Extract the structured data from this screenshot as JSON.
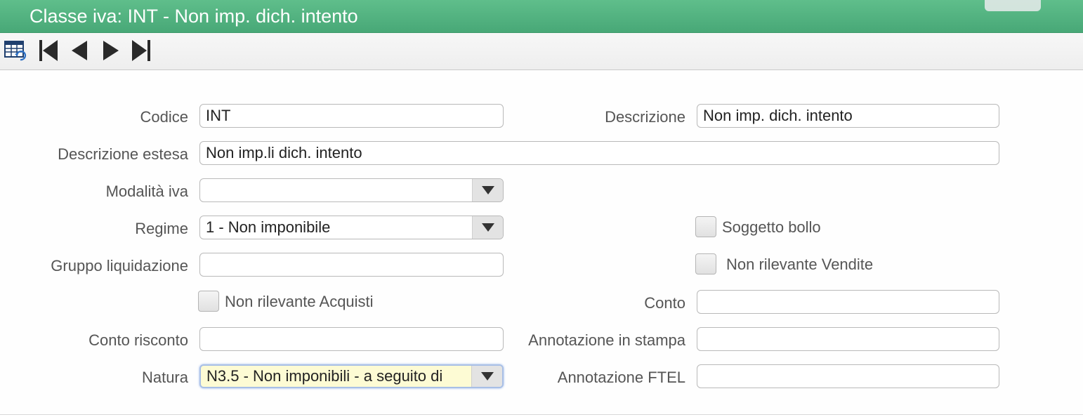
{
  "window": {
    "title": "Classe iva: INT - Non imp. dich. intento"
  },
  "toolbar": {
    "buttons": [
      {
        "name": "table-view-icon"
      },
      {
        "name": "first-record-icon"
      },
      {
        "name": "previous-record-icon"
      },
      {
        "name": "next-record-icon"
      },
      {
        "name": "last-record-icon"
      }
    ]
  },
  "form": {
    "codice": {
      "label": "Codice",
      "value": "INT"
    },
    "descrizione": {
      "label": "Descrizione",
      "value": "Non imp. dich. intento"
    },
    "descrizione_estesa": {
      "label": "Descrizione estesa",
      "value": "Non imp.li dich. intento"
    },
    "modalita_iva": {
      "label": "Modalità iva",
      "value": ""
    },
    "regime": {
      "label": "Regime",
      "value": "1 - Non imponibile"
    },
    "soggetto_bollo": {
      "label": "Soggetto bollo",
      "checked": false
    },
    "gruppo_liquidazione": {
      "label": "Gruppo liquidazione",
      "value": ""
    },
    "non_rilevante_vendite": {
      "label": "Non rilevante Vendite",
      "checked": false
    },
    "non_rilevante_acquisti": {
      "label": "Non rilevante Acquisti",
      "checked": false
    },
    "conto": {
      "label": "Conto",
      "value": ""
    },
    "conto_risconto": {
      "label": "Conto risconto",
      "value": ""
    },
    "annotazione_stampa": {
      "label": "Annotazione in stampa",
      "value": ""
    },
    "natura": {
      "label": "Natura",
      "value": "N3.5 - Non imponibili - a seguito di"
    },
    "annotazione_ftel": {
      "label": "Annotazione FTEL",
      "value": ""
    }
  }
}
